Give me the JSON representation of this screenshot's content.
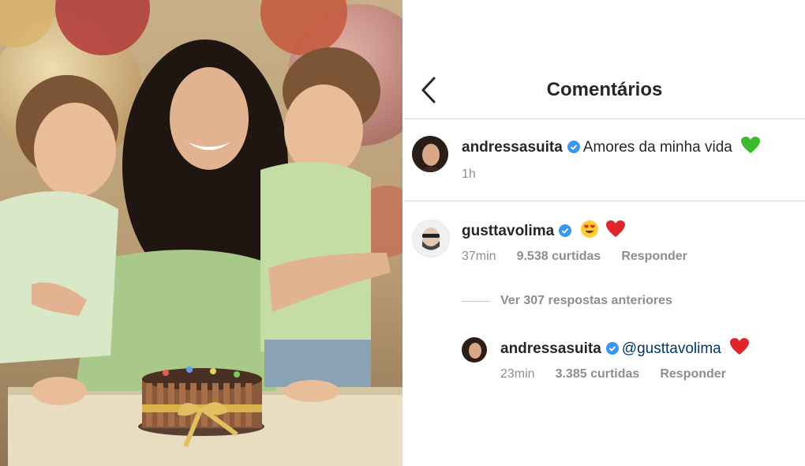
{
  "header": {
    "title": "Comentários"
  },
  "post": {
    "username": "andressasuita",
    "caption": "Amores da minha vida",
    "time": "1h",
    "emoji": "green-heart"
  },
  "comment": {
    "username": "gusttavolima",
    "emojis": [
      "heart-eyes",
      "red-heart"
    ],
    "time": "37min",
    "likes": "9.538 curtidas",
    "reply_label": "Responder"
  },
  "view_replies": "Ver 307 respostas anteriores",
  "reply": {
    "username": "andressasuita",
    "mention": "@gusttavolima",
    "emoji": "red-heart",
    "time": "23min",
    "likes": "3.385 curtidas",
    "reply_label": "Responder"
  },
  "colors": {
    "verified": "#3897f0",
    "mention": "#00376b",
    "muted": "#8e8e8e"
  }
}
